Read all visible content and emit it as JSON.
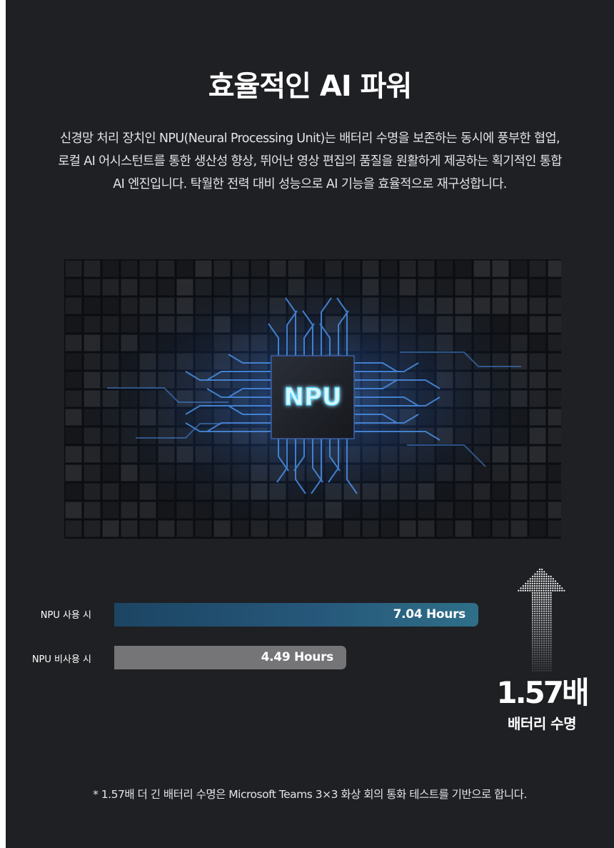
{
  "heading": {
    "title": "효율적인 AI 파워",
    "description": "신경망 처리 장치인 NPU(Neural Processing Unit)는 배터리 수명을 보존하는 동시에 풍부한 협업, 로컬 AI 어시스턴트를 통한 생산성 향상, 뛰어난 영상 편집의 품질을 원활하게 제공하는 획기적인 통합 AI 엔진입니다. 탁월한 전력 대비 성능으로 AI 기능을 효율적으로 재구성합니다."
  },
  "hero": {
    "chip_label": "NPU"
  },
  "comparison": {
    "rows": [
      {
        "label": "NPU 사용 시",
        "value_text": "7.04 Hours",
        "hours": 7.04,
        "color": "#2a6482"
      },
      {
        "label": "NPU 비사용 시",
        "value_text": "4.49 Hours",
        "hours": 4.49,
        "color": "#757578"
      }
    ],
    "ratio": "1.57배",
    "ratio_label": "배터리 수명"
  },
  "footnote": "* 1.57배 더 긴 배터리 수명은 Microsoft Teams 3×3 화상 회의 통화 테스트를 기반으로 합니다.",
  "colors": {
    "background": "#1f2024",
    "npu_glow": "#4fd3ff",
    "circuit": "#3d7fd8"
  }
}
